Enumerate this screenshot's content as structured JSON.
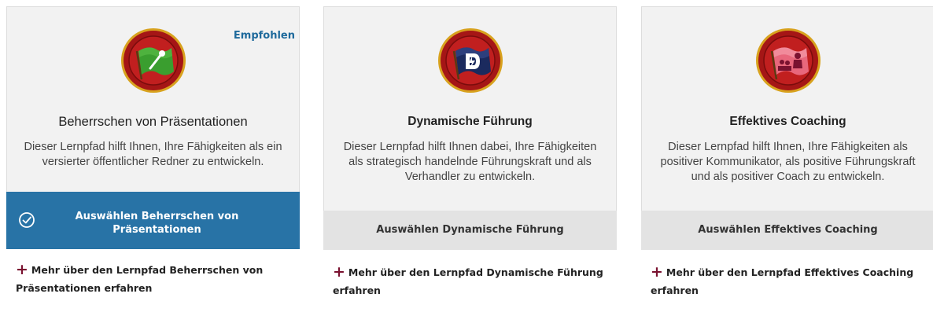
{
  "cards": [
    {
      "badge": "Empfohlen",
      "icon": "green-flag-microphone-medallion-icon",
      "title": "Beherrschen von Präsentationen",
      "description": "Dieser Lernpfad hilft Ihnen, Ihre Fähigkeiten als ein versierter öffentlicher Redner zu entwickeln.",
      "select_label": "Auswählen Beherrschen von Präsentationen",
      "selected": true,
      "more_label": "Mehr über den Lernpfad Beherrschen von Präsentationen erfahren",
      "flag_color": "#3a9e2f"
    },
    {
      "icon": "navy-flag-d-medallion-icon",
      "title": "Dynamische Führung",
      "description": "Dieser Lernpfad hilft Ihnen dabei, Ihre Fähigkeiten als strategisch handelnde Führungskraft und als Verhandler zu entwickeln.",
      "select_label": "Auswählen Dynamische Führung",
      "selected": false,
      "more_label": "Mehr über den Lernpfad Dynamische Führung erfahren",
      "flag_color": "#1b2a5e"
    },
    {
      "icon": "pink-flag-speaker-medallion-icon",
      "title": "Effektives Coaching",
      "description": "Dieser Lernpfad hilft Ihnen, Ihre Fähigkeiten als positiver Kommunikator, als positive Führungskraft und als positiver Coach zu entwickeln.",
      "select_label": "Auswählen Effektives Coaching",
      "selected": false,
      "more_label": "Mehr über den Lernpfad Effektives Coaching erfahren",
      "flag_color": "#e8677c"
    }
  ],
  "colors": {
    "accent": "#2873a6",
    "badge": "#1f6a9c",
    "plus": "#7a1230",
    "medallion_ring": "#b01818",
    "medallion_gold": "#d8a21e"
  },
  "icons": {
    "check": "check-circle-icon",
    "plus": "plus-icon"
  }
}
